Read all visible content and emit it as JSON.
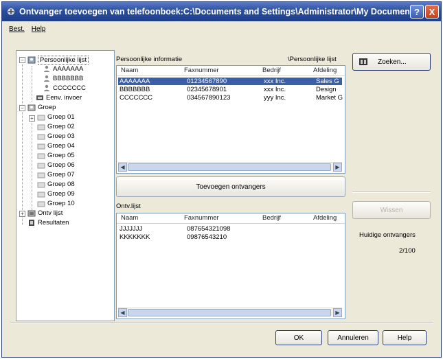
{
  "window": {
    "title": "Ontvanger toevoegen van telefoonboek:C:\\Documents and Settings\\Administrator\\My Documen..."
  },
  "titlebar_buttons": {
    "help": "?",
    "close": "X"
  },
  "menu": {
    "items": [
      "Best.",
      "Help"
    ]
  },
  "tree": {
    "personal_list": "Persoonlijke lijst",
    "contacts": [
      "AAAAAAA",
      "BBBBBBB",
      "CCCCCCC"
    ],
    "single_input": "Eenv. invoer",
    "group": "Groep",
    "groups": [
      "Groep 01",
      "Groep 02",
      "Groep 03",
      "Groep 04",
      "Groep 05",
      "Groep 06",
      "Groep 07",
      "Groep 08",
      "Groep 09",
      "Groep 10"
    ],
    "recipient_list": "Ontv lijst",
    "results": "Resultaten"
  },
  "personal_info": {
    "label": "Persoonlijke informatie",
    "path": "\\Persoonlijke lijst",
    "columns": [
      "Naam",
      "Faxnummer",
      "Bedrijf",
      "Afdeling"
    ],
    "rows": [
      [
        "AAAAAAA",
        "01234567890",
        "xxx Inc.",
        "Sales G"
      ],
      [
        "BBBBBBB",
        "02345678901",
        "xxx Inc.",
        "Design"
      ],
      [
        "CCCCCCC",
        "034567890123",
        "yyy Inc.",
        "Market G"
      ]
    ]
  },
  "add_recipients_button": "Toevoegen ontvangers",
  "recipient_panel": {
    "label": "Ontv.lijst",
    "columns": [
      "Naam",
      "Faxnummer",
      "Bedrijf",
      "Afdeling"
    ],
    "rows": [
      [
        "JJJJJJJ",
        "087654321098",
        "",
        ""
      ],
      [
        "KKKKKKK",
        "09876543210",
        "",
        ""
      ]
    ]
  },
  "search_button": "Zoeken...",
  "delete_button": "Wissen",
  "current_recipients_label": "Huidige ontvangers",
  "current_recipients_count": "2/100",
  "ok_button": "OK",
  "cancel_button": "Annuleren",
  "help_button": "Help"
}
